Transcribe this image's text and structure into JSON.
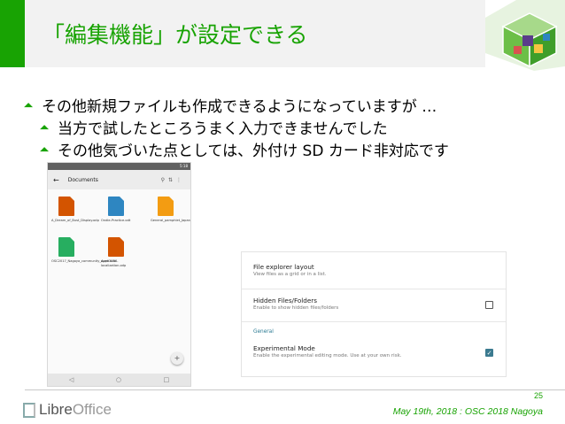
{
  "slide": {
    "title": "「編集機能」が設定できる",
    "bullets": [
      "その他新規ファイルも作成できるようになっていますが …",
      "当方で試したところうまく入力できませんでした",
      "その他気づいた点としては、外付け SD カード非対応です"
    ],
    "accent_color": "#18a303"
  },
  "phone": {
    "toolbar_title": "Documents",
    "status_time": "5:18",
    "files": [
      {
        "name": "A_Dream_of_Bust_Display.odp",
        "color": "#d35400",
        "icon": "impress-doc-icon"
      },
      {
        "name": "Ondie-Practice.odt",
        "color": "#2e86c1",
        "icon": "writer-doc-icon"
      },
      {
        "name": "General_pamphlet_Japanese.odg",
        "color": "#f39c12",
        "icon": "draw-doc-icon"
      },
      {
        "name": "OSC2017_Nagoya_community_Appli.ods",
        "color": "#27ae60",
        "icon": "calc-doc-icon"
      },
      {
        "name": "open3036-localization.odp",
        "color": "#d35400",
        "icon": "impress-doc-icon"
      }
    ],
    "fab_label": "+"
  },
  "settings": {
    "items": [
      {
        "title": "File explorer layout",
        "subtitle": "View files as a grid or in a list."
      },
      {
        "title": "Hidden Files/Folders",
        "subtitle": "Enable to show hidden files/folders",
        "checked": false
      },
      {
        "title": "Experimental Mode",
        "subtitle": "Enable the experimental editing mode. Use at your own risk.",
        "checked": true
      }
    ],
    "section_label": "General"
  },
  "footer": {
    "logo_libre": "Libre",
    "logo_office": "Office",
    "page_number": "25",
    "note": "May 19th, 2018 : OSC 2018 Nagoya"
  }
}
